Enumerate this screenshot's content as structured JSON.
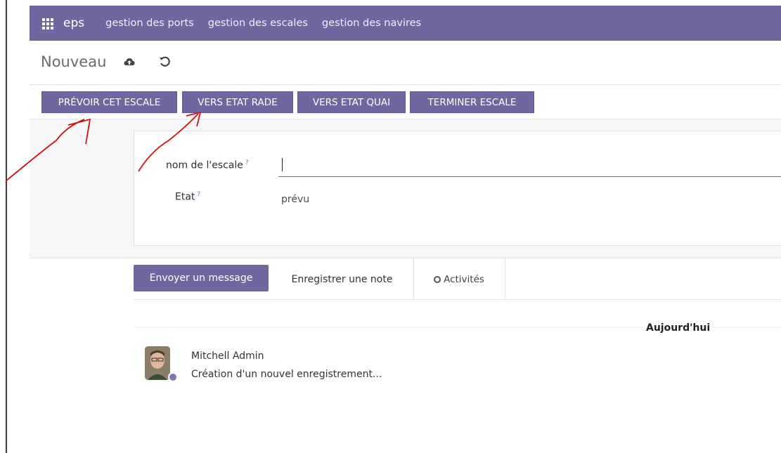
{
  "app": {
    "brand": "eps"
  },
  "menu": [
    "gestion des ports",
    "gestion des escales",
    "gestion des navires"
  ],
  "header": {
    "title": "Nouveau"
  },
  "status_buttons": [
    "PRÉVOIR CET ESCALE",
    "VERS ETAT RADE",
    "VERS ETAT QUAI",
    "TERMINER ESCALE"
  ],
  "form": {
    "name_label": "nom de l'escale",
    "name_value": "",
    "state_label": "Etat",
    "state_value": "prévu",
    "help_mark": "?"
  },
  "chatter": {
    "send_message": "Envoyer un message",
    "log_note": "Enregistrer une note",
    "activities": "Activités",
    "date_separator": "Aujourd'hui",
    "message": {
      "author": "Mitchell Admin",
      "body": "Création d'un nouvel enregistrement..."
    }
  },
  "colors": {
    "brand": "#7266a0",
    "annotation": "#d01010"
  },
  "icons": {
    "apps": "apps-grid-icon",
    "save": "cloud-upload-icon",
    "discard": "undo-icon",
    "activities": "clock-icon"
  }
}
